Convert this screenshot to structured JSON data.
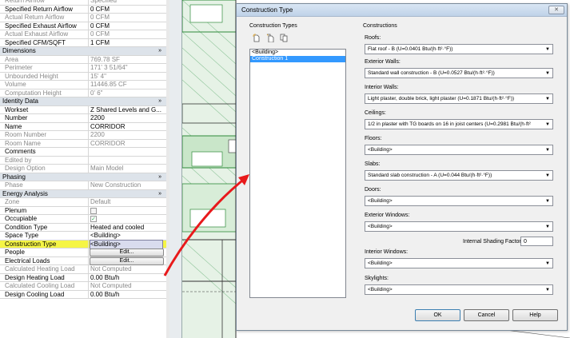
{
  "properties": {
    "rows": [
      {
        "kind": "prop",
        "label": "Return Airflow",
        "value": "Specified",
        "dim": true
      },
      {
        "kind": "prop",
        "label": "Specified Return Airflow",
        "value": "0 CFM"
      },
      {
        "kind": "prop",
        "label": "Actual Return Airflow",
        "value": "0 CFM",
        "dim": true
      },
      {
        "kind": "prop",
        "label": "Specified Exhaust Airflow",
        "value": "0 CFM"
      },
      {
        "kind": "prop",
        "label": "Actual Exhaust Airflow",
        "value": "0 CFM",
        "dim": true
      },
      {
        "kind": "prop",
        "label": "Specified CFM/SQFT",
        "value": "1 CFM"
      },
      {
        "kind": "section",
        "label": "Dimensions",
        "toggle": "»"
      },
      {
        "kind": "prop",
        "label": "Area",
        "value": "769.78 SF",
        "dim": true
      },
      {
        "kind": "prop",
        "label": "Perimeter",
        "value": "171'  3 51/64\"",
        "dim": true
      },
      {
        "kind": "prop",
        "label": "Unbounded Height",
        "value": "15'  4\"",
        "dim": true
      },
      {
        "kind": "prop",
        "label": "Volume",
        "value": "11446.85 CF",
        "dim": true
      },
      {
        "kind": "prop",
        "label": "Computation Height",
        "value": "0'  6\"",
        "dim": true
      },
      {
        "kind": "section",
        "label": "Identity Data",
        "toggle": "»"
      },
      {
        "kind": "prop",
        "label": "Workset",
        "value": "Z Shared Levels and G..."
      },
      {
        "kind": "prop",
        "label": "Number",
        "value": "2200"
      },
      {
        "kind": "prop",
        "label": "Name",
        "value": "CORRIDOR"
      },
      {
        "kind": "prop",
        "label": "Room Number",
        "value": "2200",
        "dim": true
      },
      {
        "kind": "prop",
        "label": "Room Name",
        "value": "CORRIDOR",
        "dim": true
      },
      {
        "kind": "prop",
        "label": "Comments",
        "value": ""
      },
      {
        "kind": "prop",
        "label": "Edited by",
        "value": "",
        "dim": true
      },
      {
        "kind": "prop",
        "label": "Design Option",
        "value": "Main Model",
        "dim": true
      },
      {
        "kind": "section",
        "label": "Phasing",
        "toggle": "»"
      },
      {
        "kind": "prop",
        "label": "Phase",
        "value": "New Construction",
        "dim": true
      },
      {
        "kind": "section",
        "label": "Energy Analysis",
        "toggle": "»"
      },
      {
        "kind": "prop",
        "label": "Zone",
        "value": "Default",
        "dim": true
      },
      {
        "kind": "check",
        "label": "Plenum",
        "checked": false
      },
      {
        "kind": "check",
        "label": "Occupiable",
        "checked": true
      },
      {
        "kind": "prop",
        "label": "Condition Type",
        "value": "Heated and cooled"
      },
      {
        "kind": "prop",
        "label": "Space Type",
        "value": "<Building>"
      },
      {
        "kind": "prop",
        "label": "Construction Type",
        "value": "<Building>",
        "highlight": true
      },
      {
        "kind": "button",
        "label": "People",
        "value": "Edit..."
      },
      {
        "kind": "button",
        "label": "Electrical Loads",
        "value": "Edit..."
      },
      {
        "kind": "prop",
        "label": "Calculated Heating Load",
        "value": "Not Computed",
        "dim": true
      },
      {
        "kind": "prop",
        "label": "Design Heating Load",
        "value": "0.00 Btu/h"
      },
      {
        "kind": "prop",
        "label": "Calculated Cooling Load",
        "value": "Not Computed",
        "dim": true
      },
      {
        "kind": "prop",
        "label": "Design Cooling Load",
        "value": "0.00 Btu/h"
      }
    ]
  },
  "dialog": {
    "title": "Construction Type",
    "close_label": "✕",
    "types_heading": "Construction Types",
    "types": [
      "<Building>",
      "Construction 1"
    ],
    "selected_type": "Construction 1",
    "constructions_heading": "Constructions",
    "fields": [
      {
        "label": "Roofs:",
        "value": "Flat roof - B (U=0.0401 Btu/(h·ft²·°F))"
      },
      {
        "label": "Exterior Walls:",
        "value": "Standard wall construction - B (U=0.0527 Btu/(h·ft²·°F))"
      },
      {
        "label": "Interior Walls:",
        "value": "Light plaster, double brick, light plaster (U=0.1871 Btu/(h·ft²·°F))"
      },
      {
        "label": "Ceilings:",
        "value": "1/2 in plaster with TG boards on 16 in joist centers (U=0.2981 Btu/(h·ft²"
      },
      {
        "label": "Floors:",
        "value": "<Building>"
      },
      {
        "label": "Slabs:",
        "value": "Standard slab construction - A (U=0.044 Btu/(h·ft²·°F))"
      },
      {
        "label": "Doors:",
        "value": "<Building>"
      },
      {
        "label": "Exterior Windows:",
        "value": "<Building>"
      },
      {
        "label": "Interior Windows:",
        "value": "<Building>"
      },
      {
        "label": "Skylights:",
        "value": "<Building>"
      }
    ],
    "shading_label": "Internal Shading Factor:",
    "shading_value": "0",
    "ok_label": "OK",
    "cancel_label": "Cancel",
    "help_label": "Help"
  },
  "colors": {
    "highlight": "#f5f545",
    "arrow": "#e8191b",
    "selection": "#3399ff",
    "drawing_green": "#2e8b3a"
  }
}
